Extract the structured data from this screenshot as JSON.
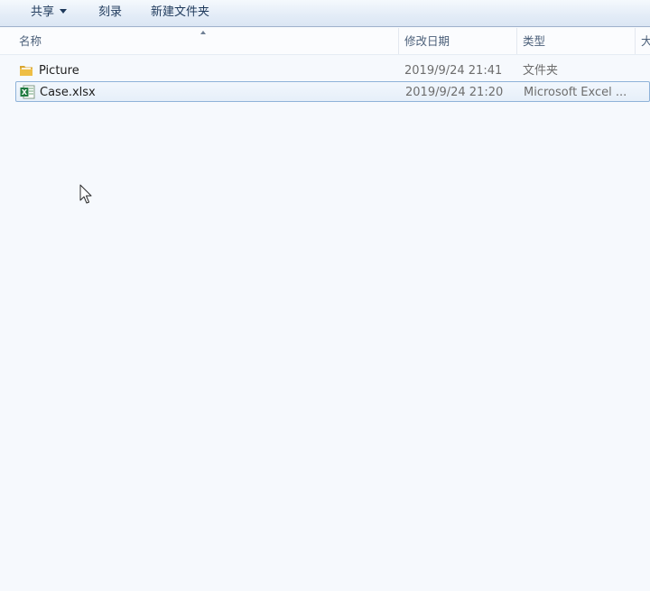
{
  "toolbar": {
    "share_label": "共享",
    "burn_label": "刻录",
    "new_folder_label": "新建文件夹"
  },
  "columns": {
    "name": "名称",
    "date_modified": "修改日期",
    "type": "类型",
    "size": "大"
  },
  "files": [
    {
      "name": "Picture",
      "date": "2019/9/24 21:41",
      "type": "文件夹",
      "icon": "folder-icon"
    },
    {
      "name": "Case.xlsx",
      "date": "2019/9/24 21:20",
      "type": "Microsoft Excel ...",
      "icon": "excel-file-icon"
    }
  ],
  "colors": {
    "folder": "#e8b93f",
    "excel": "#1f7a3f",
    "selection_border": "#8fb3d9"
  }
}
